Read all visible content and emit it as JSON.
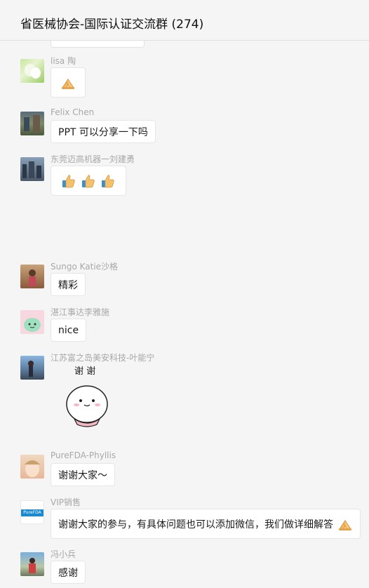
{
  "header": {
    "title": "省医械协会-国际认证交流群 (274)"
  },
  "messages": [
    {
      "sender": "lisa 陶",
      "content_type": "emoji",
      "emoji": [
        "pray-emoji"
      ]
    },
    {
      "sender": "Felix Chen",
      "content_type": "text",
      "text": "PPT 可以分享一下吗"
    },
    {
      "sender": "东莞迈高机器一刘建勇",
      "content_type": "emoji",
      "emoji": [
        "thumbs-up-emoji",
        "thumbs-up-emoji",
        "thumbs-up-emoji"
      ]
    },
    {
      "sender": "Sungo  Katie沙格",
      "content_type": "text",
      "text": "精彩"
    },
    {
      "sender": "湛江事达李雅施",
      "content_type": "text",
      "text": "nice"
    },
    {
      "sender": "江苏富之岛美安科技-叶能宁",
      "content_type": "sticker",
      "sticker_text": "谢 谢"
    },
    {
      "sender": "PureFDA-Phyllis",
      "content_type": "text",
      "text": "谢谢大家～"
    },
    {
      "sender": "VIP销售",
      "content_type": "text",
      "text": "谢谢大家的参与，有具体问题也可以添加微信，我们做详细解答",
      "avatar_text": "PureFDA"
    },
    {
      "sender": "冯小兵",
      "content_type": "text",
      "text": "感谢"
    }
  ]
}
